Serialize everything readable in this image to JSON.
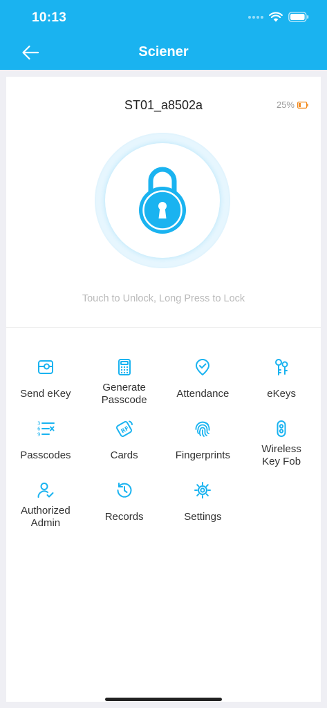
{
  "status_bar": {
    "time": "10:13"
  },
  "nav": {
    "title": "Sciener"
  },
  "device": {
    "name": "ST01_a8502a",
    "battery": "25%"
  },
  "lock": {
    "hint": "Touch to Unlock, Long Press to Lock"
  },
  "colors": {
    "accent": "#1ab3f0",
    "battery_low": "#f28a1e"
  },
  "menu": [
    {
      "label": "Send eKey",
      "icon": "send-ekey-icon"
    },
    {
      "label": "Generate\nPasscode",
      "icon": "keypad-icon"
    },
    {
      "label": "Attendance",
      "icon": "attendance-icon"
    },
    {
      "label": "eKeys",
      "icon": "keys-icon"
    },
    {
      "label": "Passcodes",
      "icon": "passcode-list-icon"
    },
    {
      "label": "Cards",
      "icon": "rf-card-icon"
    },
    {
      "label": "Fingerprints",
      "icon": "fingerprint-icon"
    },
    {
      "label": "Wireless\nKey Fob",
      "icon": "key-fob-icon"
    },
    {
      "label": "Authorized\nAdmin",
      "icon": "admin-user-icon"
    },
    {
      "label": "Records",
      "icon": "history-icon"
    },
    {
      "label": "Settings",
      "icon": "gear-icon"
    }
  ]
}
